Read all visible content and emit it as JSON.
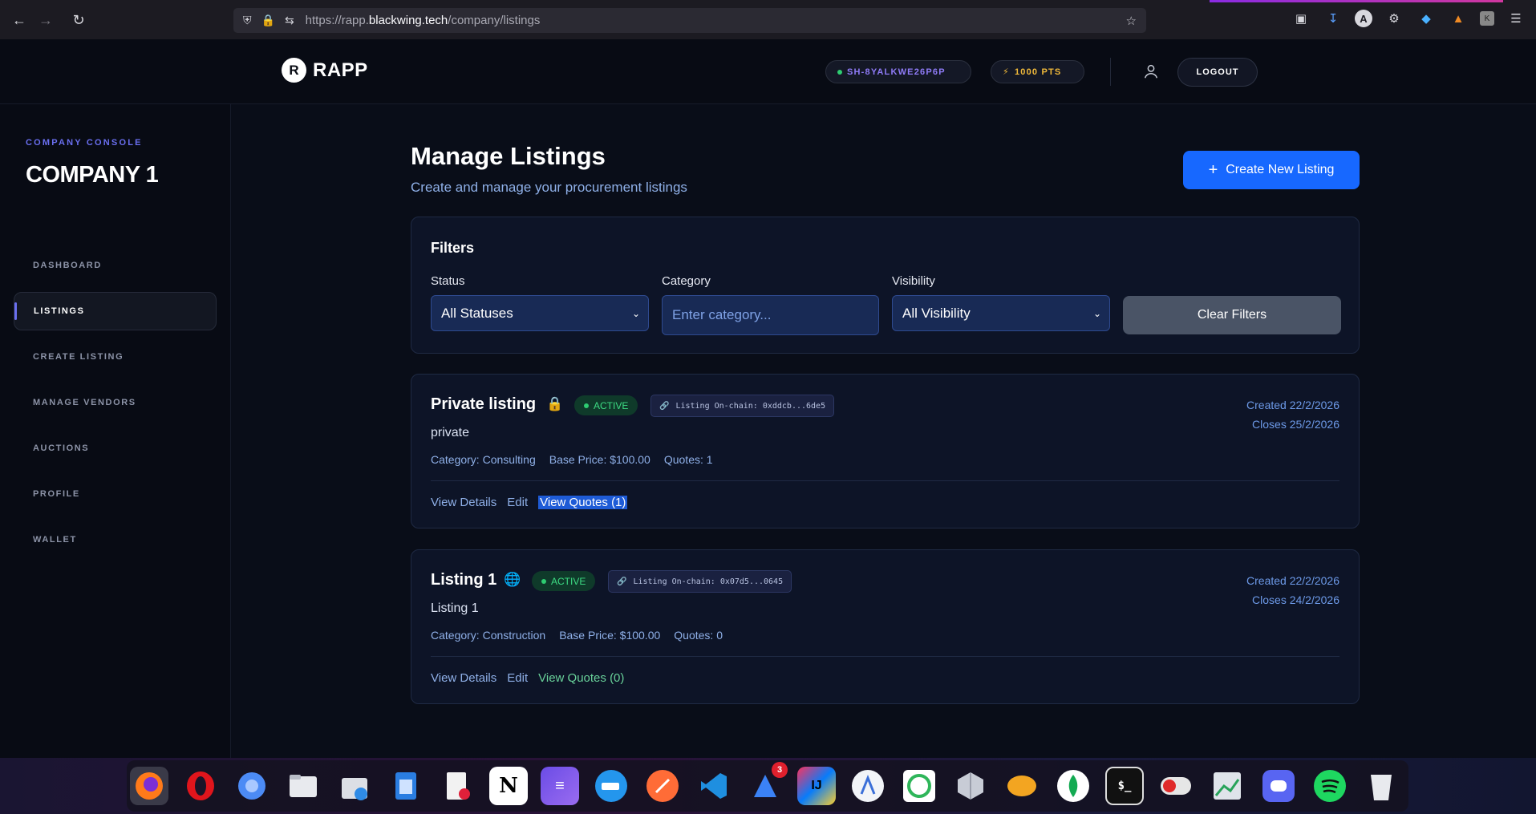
{
  "browser": {
    "url_prefix": "https://rapp.",
    "url_host": "blackwing.tech",
    "url_path": "/company/listings"
  },
  "header": {
    "logo_mark": "R",
    "logo_text": "RAPP",
    "session_id": "SH-8YALKWE26P6P",
    "points": "1000 PTS",
    "logout_label": "LOGOUT"
  },
  "sidebar": {
    "console_label": "COMPANY CONSOLE",
    "company_name": "COMPANY 1",
    "items": [
      {
        "label": "DASHBOARD"
      },
      {
        "label": "LISTINGS"
      },
      {
        "label": "CREATE LISTING"
      },
      {
        "label": "MANAGE VENDORS"
      },
      {
        "label": "AUCTIONS"
      },
      {
        "label": "PROFILE"
      },
      {
        "label": "WALLET"
      }
    ]
  },
  "main": {
    "title": "Manage Listings",
    "subtitle": "Create and manage your procurement listings",
    "create_button": "Create New Listing",
    "create_icon": "+"
  },
  "filters": {
    "title": "Filters",
    "status_label": "Status",
    "status_value": "All Statuses",
    "category_label": "Category",
    "category_placeholder": "Enter category...",
    "visibility_label": "Visibility",
    "visibility_value": "All Visibility",
    "clear_label": "Clear Filters"
  },
  "listings": [
    {
      "title": "Private listing",
      "visibility_icon": "lock-icon",
      "status": "ACTIVE",
      "chain": "Listing On-chain: 0xddcb...6de5",
      "description": "private",
      "category": "Category: Consulting",
      "base_price": "Base Price: $100.00",
      "quotes": "Quotes: 1",
      "created": "Created 22/2/2026",
      "closes": "Closes 25/2/2026",
      "view_details": "View Details",
      "edit": "Edit",
      "view_quotes": "View Quotes (1)"
    },
    {
      "title": "Listing 1",
      "visibility_icon": "globe-icon",
      "status": "ACTIVE",
      "chain": "Listing On-chain: 0x07d5...0645",
      "description": "Listing 1",
      "category": "Category: Construction",
      "base_price": "Base Price: $100.00",
      "quotes": "Quotes: 0",
      "created": "Created 22/2/2026",
      "closes": "Closes 24/2/2026",
      "view_details": "View Details",
      "edit": "Edit",
      "view_quotes": "View Quotes (0)"
    }
  ],
  "dock": {
    "badge_count": "3",
    "apps": [
      "firefox-icon",
      "opera-icon",
      "chromium-icon",
      "files-icon",
      "archive-manager-icon",
      "libreoffice-writer-icon",
      "text-editor-icon",
      "notion-icon",
      "planner-icon",
      "docker-icon",
      "postman-icon",
      "vscode-icon",
      "app-with-badge-icon",
      "intellij-icon",
      "app-store-icon",
      "sync-icon",
      "3d-app-icon",
      "database-elephant-icon",
      "mongodb-icon",
      "terminal-icon",
      "toggle-app-icon",
      "monitor-icon",
      "discord-icon",
      "spotify-icon",
      "trash-icon"
    ],
    "labels": {
      "notion": "N",
      "intellij": "IJ",
      "terminal": "$_"
    }
  }
}
